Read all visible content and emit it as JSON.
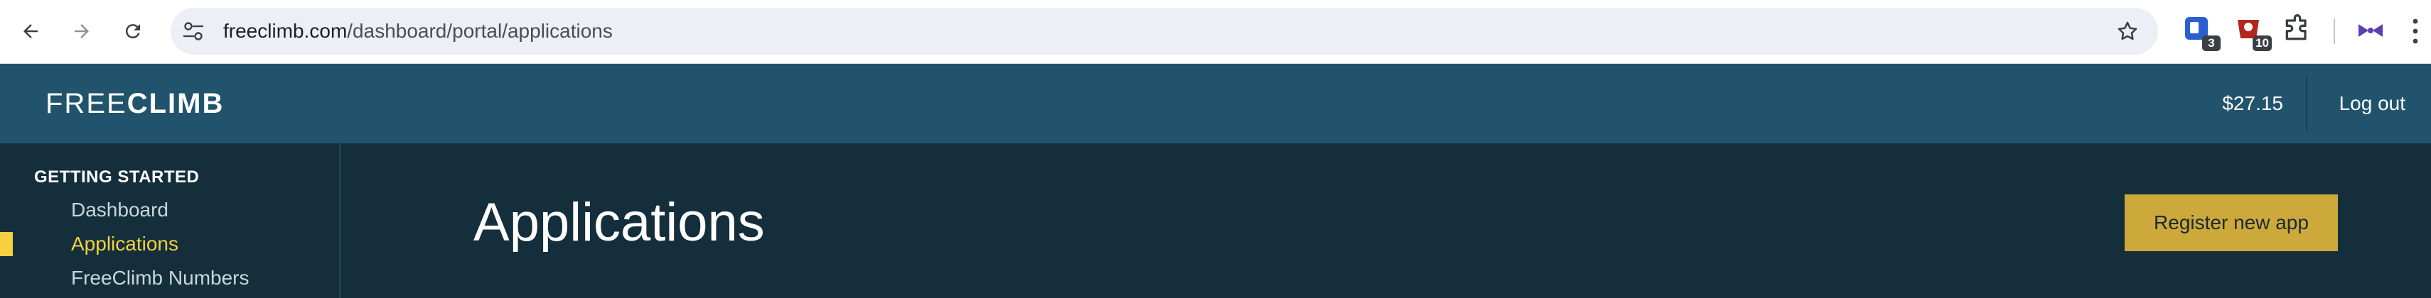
{
  "browser": {
    "url_host": "freeclimb.com",
    "url_path": "/dashboard/portal/applications",
    "icons": [
      "back-arrow-icon",
      "forward-arrow-icon",
      "reload-icon",
      "site-settings-icon",
      "bookmark-star-icon",
      "extension-icon",
      "extensions-puzzle-icon",
      "more-menu-icon"
    ],
    "extension_badges": [
      "3",
      "10"
    ]
  },
  "header": {
    "logo_light": "FREE",
    "logo_bold": "CLIMB",
    "balance": "$27.15",
    "logout_label": "Log out"
  },
  "sidebar": {
    "heading": "GETTING STARTED",
    "items": [
      {
        "label": "Dashboard",
        "active": false
      },
      {
        "label": "Applications",
        "active": true
      },
      {
        "label": "FreeClimb Numbers",
        "active": false
      }
    ],
    "accent_color": "#f5d03f"
  },
  "main": {
    "title": "Applications",
    "register_label": "Register new app",
    "button_color": "#cca93a"
  }
}
